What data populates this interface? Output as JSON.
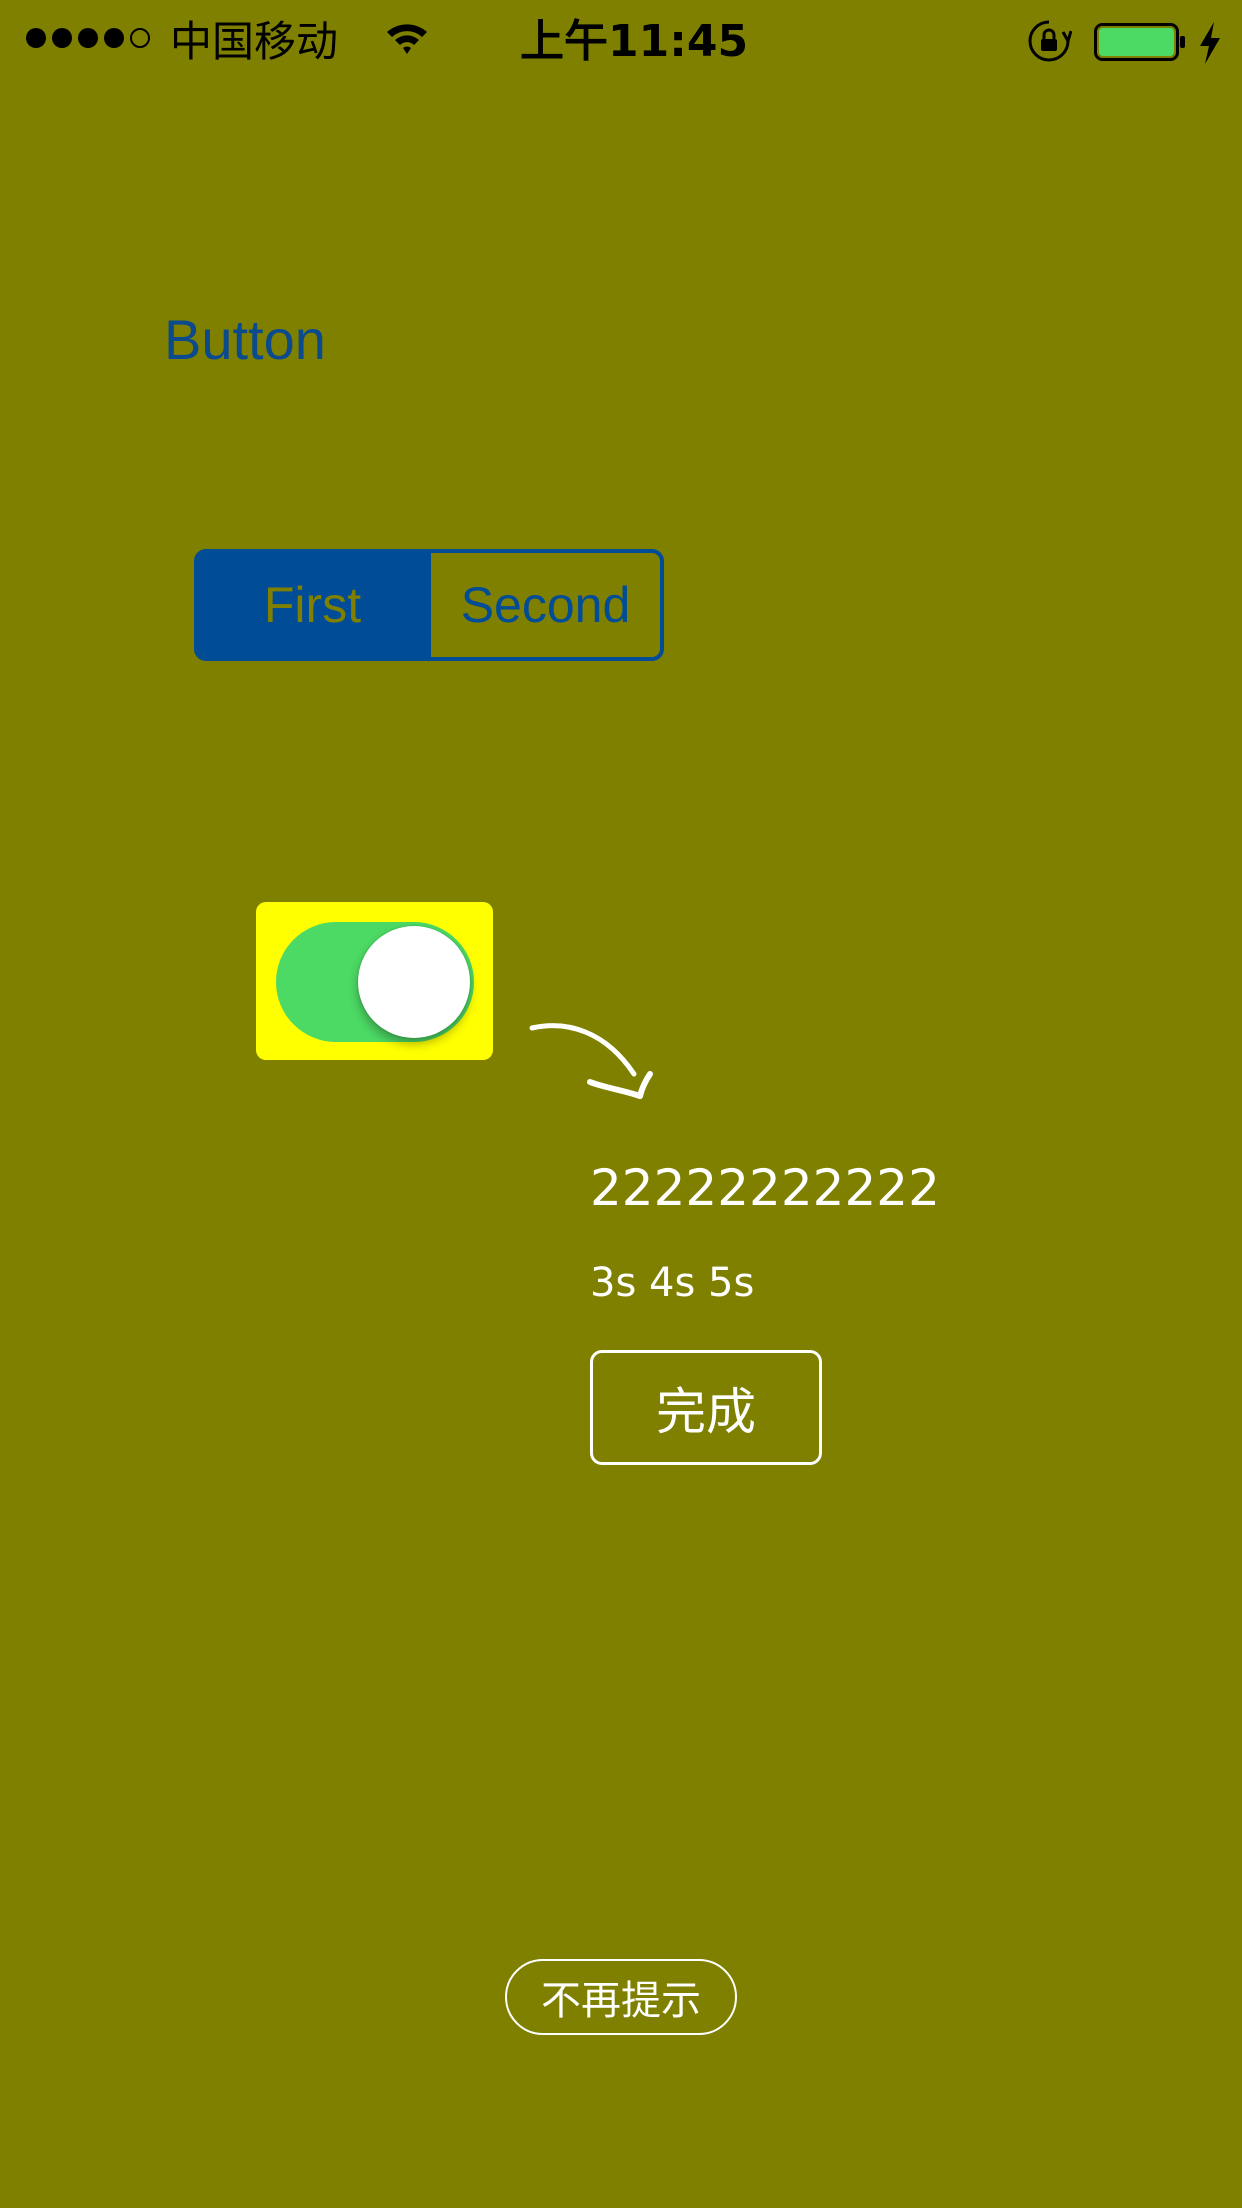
{
  "status_bar": {
    "carrier": "中国移动",
    "time": "上午11:45",
    "signal_filled": 4,
    "signal_total": 5,
    "battery_color": "#4cd964"
  },
  "main": {
    "button_label": "Button",
    "segments": [
      "First",
      "Second"
    ],
    "selected_segment": 0,
    "switch_on": true,
    "switch_on_color": "#4cd964",
    "switch_bg_color": "#ffff00",
    "number_text": "22222222222",
    "time_text": "3s 4s 5s",
    "done_label": "完成",
    "no_remind_label": "不再提示"
  },
  "colors": {
    "background": "#7f8000",
    "accent": "#004c97"
  }
}
